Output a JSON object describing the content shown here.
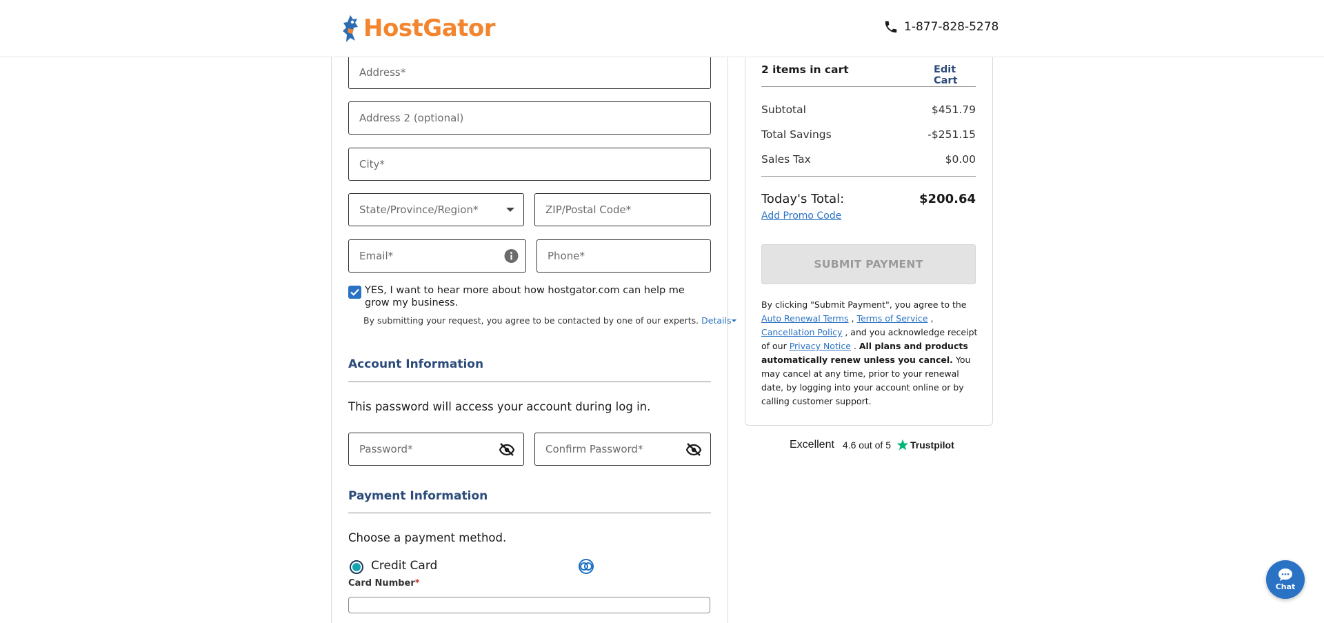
{
  "header": {
    "logo_text": "HostGator",
    "phone": "1-877-828-5278"
  },
  "billing": {
    "address_placeholder": "Address*",
    "address2_placeholder": "Address 2 (optional)",
    "city_placeholder": "City*",
    "state_placeholder": "State/Province/Region*",
    "zip_placeholder": "ZIP/Postal Code*",
    "email_placeholder": "Email*",
    "phone_placeholder": "Phone*",
    "optin_checked": true,
    "optin_text": "YES, I want to hear more about how hostgator.com can help me grow my business.",
    "consent_text": "By submitting your request, you agree to be contacted by one of our experts.",
    "details_link": "Details"
  },
  "account": {
    "title": "Account Information",
    "description": "This password will access your account during log in.",
    "password_placeholder": "Password*",
    "confirm_placeholder": "Confirm Password*"
  },
  "payment": {
    "title": "Payment Information",
    "description": "Choose a payment method.",
    "method_label": "Credit Card",
    "card_number_label": "Card Number",
    "required_mark": "*"
  },
  "cart": {
    "count_label": "2 items in cart",
    "edit_label": "Edit Cart",
    "subtotal_label": "Subtotal",
    "subtotal_value": "$451.79",
    "savings_label": "Total Savings",
    "savings_value": "-$251.15",
    "tax_label": "Sales Tax",
    "tax_value": "$0.00",
    "total_label": "Today's Total:",
    "total_value": "$200.64",
    "promo_label": "Add Promo Code",
    "submit_label": "SUBMIT PAYMENT",
    "terms": {
      "prefix": "By clicking \"Submit Payment\", you agree to the",
      "auto_renewal": "Auto Renewal Terms",
      "tos": "Terms of Service",
      "cancellation": "Cancellation Policy",
      "ack": ", and you acknowledge receipt of our",
      "privacy": "Privacy Notice",
      "bold": "All plans and products automatically renew unless you cancel.",
      "suffix": "You may cancel at any time, prior to your renewal date, by logging into your account online or by calling customer support."
    }
  },
  "trustpilot": {
    "excellent": "Excellent",
    "rating": "4.6 out of 5",
    "brand": "Trustpilot"
  },
  "chat": {
    "label": "Chat"
  },
  "colors": {
    "brand_orange": "#f2852e",
    "link_blue": "#2a72c4",
    "section_navy": "#2b4b7a",
    "radio_teal": "#12a5b4",
    "trustpilot_green": "#00b67a"
  }
}
